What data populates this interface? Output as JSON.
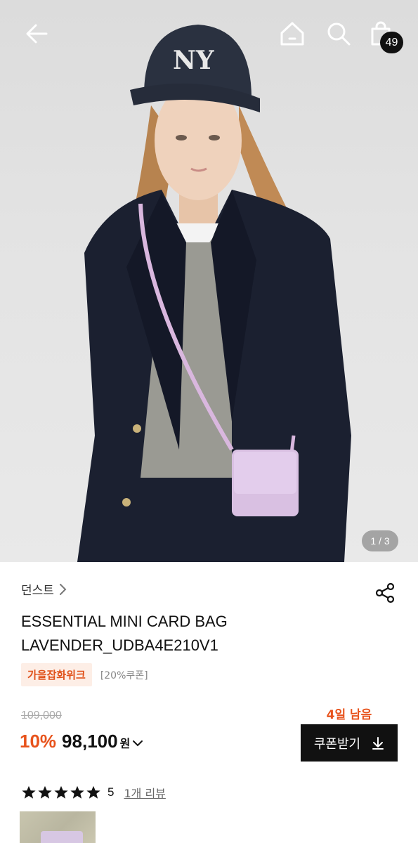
{
  "header": {
    "back_icon": "arrow-left-icon",
    "home_icon": "home-icon",
    "search_icon": "search-icon",
    "cart_icon": "shopping-bag-icon",
    "cart_count": "49"
  },
  "gallery": {
    "pager": "1 / 3"
  },
  "product": {
    "brand": "던스트",
    "title_line1": "ESSENTIAL MINI CARD BAG",
    "title_line2": "LAVENDER_UDBA4E210V1",
    "event_tag": "가을잡화위크",
    "coupon_note": "[20%쿠폰]",
    "share_icon": "share-icon"
  },
  "price": {
    "original": "109,000",
    "discount": "10%",
    "final": "98,100",
    "currency": "원"
  },
  "coupon": {
    "days_left": "4일 남음",
    "button_label": "쿠폰받기",
    "button_icon": "download-icon"
  },
  "review": {
    "stars": 5,
    "rating": "5",
    "link": "1개 리뷰"
  },
  "colors": {
    "accent": "#e8531c",
    "tag_bg": "#fdeee6",
    "button_bg": "#111111"
  }
}
